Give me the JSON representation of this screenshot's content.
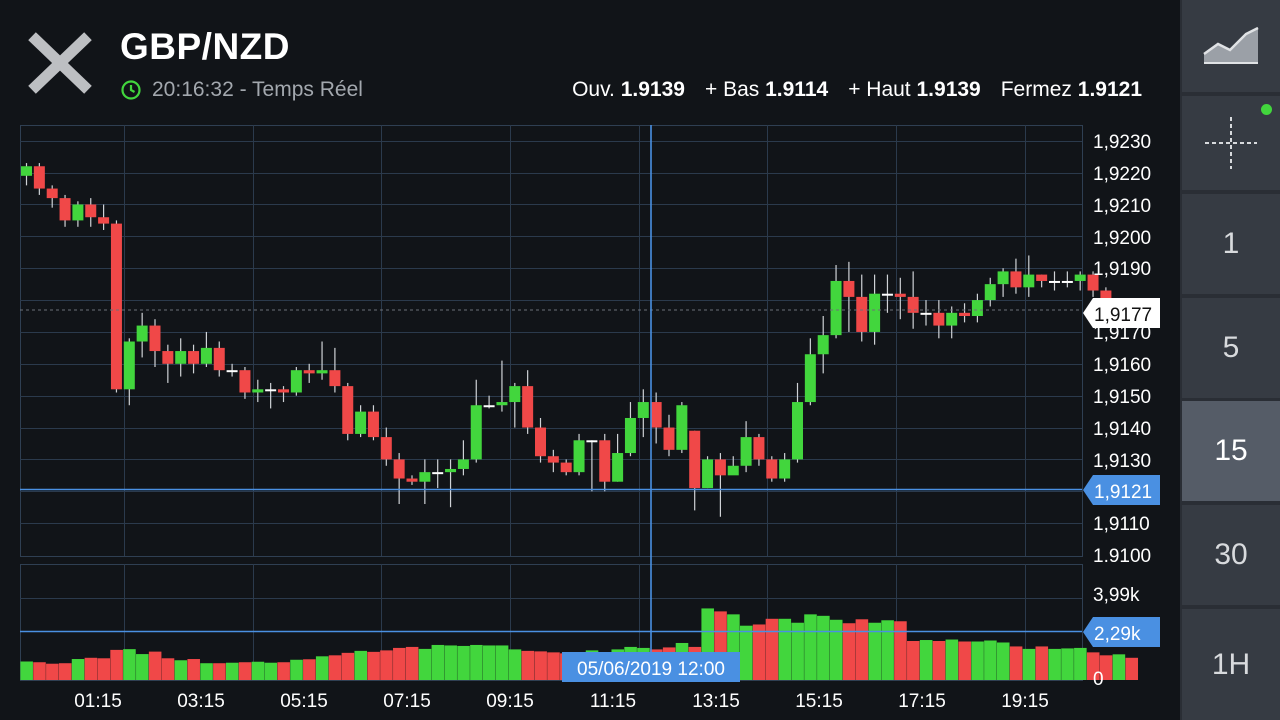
{
  "header": {
    "pair": "GBP/NZD",
    "time": "20:16:32",
    "mode": "Temps Réel",
    "ohlc": {
      "open_label": "Ouv.",
      "open": "1.9139",
      "low_label": "+ Bas",
      "low": "1.9114",
      "high_label": "+ Haut",
      "high": "1.9139",
      "close_label": "Fermez",
      "close": "1.9121"
    }
  },
  "sidebar": {
    "chart_type_icon": "line-chart-icon",
    "crosshair_icon": "crosshair-icon",
    "status_color": "#42d63d",
    "intervals": [
      "1",
      "5",
      "15",
      "30",
      "1H"
    ],
    "active_interval": "15"
  },
  "colors": {
    "up": "#42d63d",
    "down": "#f04848",
    "crosshair": "#4a90e2",
    "grid": "#2b3a4c",
    "background": "#111418"
  },
  "chart_data": {
    "type": "candlestick",
    "price_ticks": [
      "1,9230",
      "1,9220",
      "1,9210",
      "1,9200",
      "1,9190",
      "1,9170",
      "1,9160",
      "1,9150",
      "1,9140",
      "1,9130",
      "1,9110",
      "1.9100"
    ],
    "current_price_label": "1,9177",
    "crosshair_price_label": "1,9121",
    "price_range": [
      1.91,
      1.9235
    ],
    "time_ticks": [
      "01:15",
      "03:15",
      "05:15",
      "07:15",
      "09:15",
      "11:15",
      "13:15",
      "15:15",
      "17:15",
      "19:15"
    ],
    "crosshair_date_label": "05/06/2019 12:00",
    "volume_ticks": [
      "3,99k",
      "0"
    ],
    "volume_crosshair_label": "2,29k",
    "volume_range": [
      0,
      4.7
    ],
    "candles": [
      [
        1.9219,
        1.9222,
        1.9223,
        1.9216
      ],
      [
        1.9222,
        1.9215,
        1.9223,
        1.9213
      ],
      [
        1.9215,
        1.9212,
        1.9216,
        1.9209
      ],
      [
        1.9212,
        1.9205,
        1.9213,
        1.9203
      ],
      [
        1.9205,
        1.921,
        1.9211,
        1.9203
      ],
      [
        1.921,
        1.9206,
        1.9212,
        1.9203
      ],
      [
        1.9206,
        1.9204,
        1.921,
        1.9202
      ],
      [
        1.9204,
        1.9152,
        1.9205,
        1.9151
      ],
      [
        1.9152,
        1.9167,
        1.9168,
        1.9147
      ],
      [
        1.9167,
        1.9172,
        1.9176,
        1.9162
      ],
      [
        1.9172,
        1.9164,
        1.9174,
        1.9159
      ],
      [
        1.9164,
        1.916,
        1.9166,
        1.9154
      ],
      [
        1.916,
        1.9164,
        1.9168,
        1.9156
      ],
      [
        1.9164,
        1.916,
        1.9166,
        1.9157
      ],
      [
        1.916,
        1.9165,
        1.917,
        1.9159
      ],
      [
        1.9165,
        1.9158,
        1.9167,
        1.9156
      ],
      [
        1.9158,
        1.9158,
        1.916,
        1.9156
      ],
      [
        1.9158,
        1.9151,
        1.9159,
        1.9149
      ],
      [
        1.9151,
        1.9152,
        1.9155,
        1.9148
      ],
      [
        1.9152,
        1.9152,
        1.9154,
        1.9146
      ],
      [
        1.9152,
        1.9151,
        1.9153,
        1.9148
      ],
      [
        1.9151,
        1.9158,
        1.9159,
        1.915
      ],
      [
        1.9158,
        1.9157,
        1.916,
        1.9154
      ],
      [
        1.9157,
        1.9158,
        1.9167,
        1.9155
      ],
      [
        1.9158,
        1.9153,
        1.9165,
        1.9151
      ],
      [
        1.9153,
        1.9138,
        1.9154,
        1.9136
      ],
      [
        1.9138,
        1.9145,
        1.9147,
        1.9137
      ],
      [
        1.9145,
        1.9137,
        1.9147,
        1.9136
      ],
      [
        1.9137,
        1.913,
        1.914,
        1.9128
      ],
      [
        1.913,
        1.9124,
        1.9132,
        1.9116
      ],
      [
        1.9124,
        1.9123,
        1.9125,
        1.9122
      ],
      [
        1.9123,
        1.9126,
        1.913,
        1.9116
      ],
      [
        1.9126,
        1.9126,
        1.913,
        1.9121
      ],
      [
        1.9126,
        1.9127,
        1.913,
        1.9115
      ],
      [
        1.9127,
        1.913,
        1.9136,
        1.9125
      ],
      [
        1.913,
        1.9147,
        1.9155,
        1.9129
      ],
      [
        1.9147,
        1.9147,
        1.915,
        1.9146
      ],
      [
        1.9147,
        1.9148,
        1.9161,
        1.9145
      ],
      [
        1.9148,
        1.9153,
        1.9154,
        1.914
      ],
      [
        1.9153,
        1.914,
        1.9158,
        1.9138
      ],
      [
        1.914,
        1.9131,
        1.9143,
        1.9129
      ],
      [
        1.9131,
        1.9129,
        1.9133,
        1.9126
      ],
      [
        1.9129,
        1.9126,
        1.913,
        1.9125
      ],
      [
        1.9126,
        1.9136,
        1.9138,
        1.9125
      ],
      [
        1.9136,
        1.9136,
        1.9136,
        1.912
      ],
      [
        1.9136,
        1.9123,
        1.9138,
        1.912
      ],
      [
        1.9123,
        1.9132,
        1.9138,
        1.9123
      ],
      [
        1.9132,
        1.9143,
        1.9148,
        1.9131
      ],
      [
        1.9143,
        1.9148,
        1.9152,
        1.9137
      ],
      [
        1.9148,
        1.914,
        1.9151,
        1.9135
      ],
      [
        1.914,
        1.9133,
        1.9144,
        1.9131
      ],
      [
        1.9133,
        1.9147,
        1.9148,
        1.9132
      ],
      [
        1.9139,
        1.9121,
        1.9139,
        1.9114
      ],
      [
        1.9121,
        1.913,
        1.9131,
        1.9121
      ],
      [
        1.913,
        1.9125,
        1.9132,
        1.9112
      ],
      [
        1.9125,
        1.9128,
        1.9131,
        1.9127
      ],
      [
        1.9128,
        1.9137,
        1.9142,
        1.9126
      ],
      [
        1.9137,
        1.913,
        1.9138,
        1.9128
      ],
      [
        1.913,
        1.9124,
        1.9131,
        1.9123
      ],
      [
        1.9124,
        1.913,
        1.9132,
        1.9123
      ],
      [
        1.913,
        1.9148,
        1.9154,
        1.9129
      ],
      [
        1.9148,
        1.9163,
        1.9168,
        1.9147
      ],
      [
        1.9163,
        1.9169,
        1.9175,
        1.9157
      ],
      [
        1.9169,
        1.9186,
        1.9191,
        1.9168
      ],
      [
        1.9186,
        1.9181,
        1.9192,
        1.917
      ],
      [
        1.9181,
        1.917,
        1.9188,
        1.9167
      ],
      [
        1.917,
        1.9182,
        1.9188,
        1.9166
      ],
      [
        1.9182,
        1.9182,
        1.9188,
        1.9176
      ],
      [
        1.9182,
        1.9181,
        1.9187,
        1.9174
      ],
      [
        1.9181,
        1.9176,
        1.9189,
        1.9171
      ],
      [
        1.9176,
        1.9176,
        1.918,
        1.9172
      ],
      [
        1.9176,
        1.9172,
        1.918,
        1.9168
      ],
      [
        1.9172,
        1.9176,
        1.9178,
        1.9168
      ],
      [
        1.9176,
        1.9175,
        1.9179,
        1.9173
      ],
      [
        1.9175,
        1.918,
        1.9182,
        1.9173
      ],
      [
        1.918,
        1.9185,
        1.9187,
        1.9178
      ],
      [
        1.9185,
        1.9189,
        1.919,
        1.9181
      ],
      [
        1.9189,
        1.9184,
        1.9193,
        1.9182
      ],
      [
        1.9184,
        1.9188,
        1.9194,
        1.9181
      ],
      [
        1.9188,
        1.9186,
        1.9188,
        1.9184
      ],
      [
        1.9186,
        1.9186,
        1.9189,
        1.9183
      ],
      [
        1.9186,
        1.9186,
        1.9189,
        1.9184
      ],
      [
        1.9186,
        1.9188,
        1.9189,
        1.9183
      ],
      [
        1.9188,
        1.9183,
        1.9189,
        1.9181
      ],
      [
        1.9183,
        1.9176,
        1.9184,
        1.9175
      ],
      [
        1.9176,
        1.9176,
        1.9178,
        1.9173
      ],
      [
        1.9176,
        1.9174,
        1.9177,
        1.9173
      ]
    ],
    "volumes": [
      0.75,
      0.72,
      0.66,
      0.68,
      0.85,
      0.9,
      0.88,
      1.22,
      1.25,
      1.05,
      1.15,
      0.88,
      0.8,
      0.85,
      0.68,
      0.68,
      0.7,
      0.72,
      0.74,
      0.7,
      0.72,
      0.82,
      0.84,
      0.96,
      1.0,
      1.1,
      1.18,
      1.14,
      1.2,
      1.3,
      1.34,
      1.26,
      1.42,
      1.4,
      1.38,
      1.42,
      1.4,
      1.4,
      1.24,
      1.18,
      1.16,
      1.12,
      1.08,
      1.12,
      1.2,
      1.12,
      1.24,
      1.34,
      1.3,
      1.24,
      1.32,
      1.5,
      1.34,
      2.9,
      2.78,
      2.66,
      2.2,
      2.25,
      2.48,
      2.48,
      2.32,
      2.66,
      2.6,
      2.44,
      2.3,
      2.46,
      2.32,
      2.42,
      2.38,
      1.58,
      1.62,
      1.58,
      1.64,
      1.56,
      1.56,
      1.6,
      1.52,
      1.36,
      1.26,
      1.36,
      1.26,
      1.28,
      1.3,
      1.12,
      1.0,
      1.04,
      0.9
    ]
  }
}
